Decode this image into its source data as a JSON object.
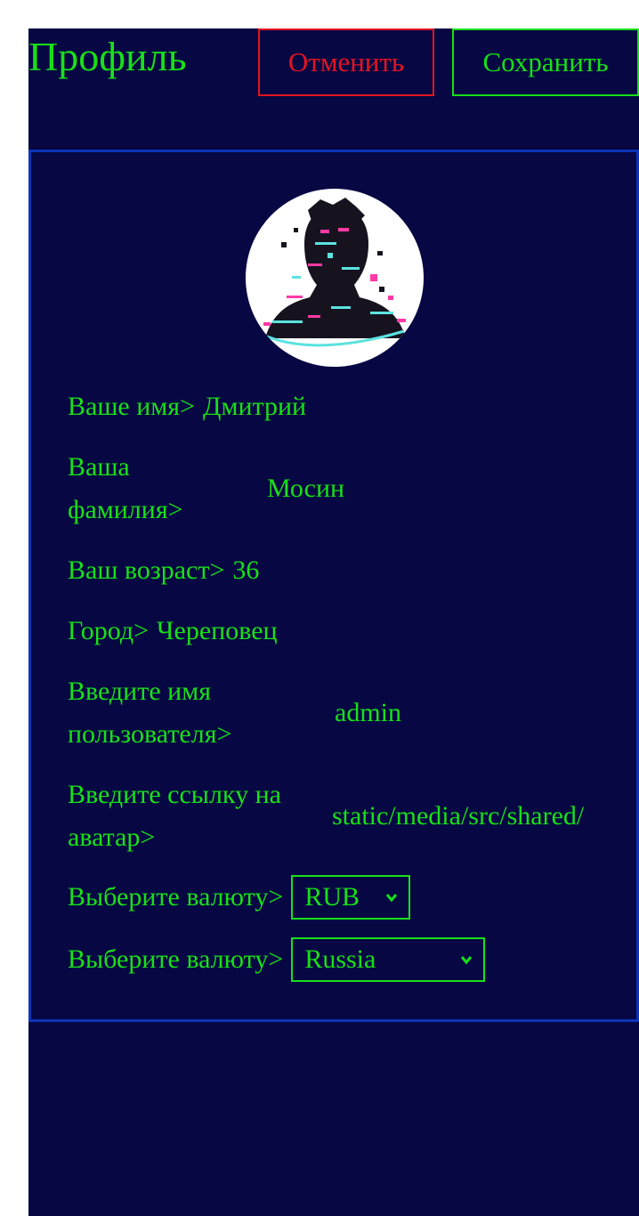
{
  "header": {
    "title": "Профиль",
    "cancel_label": "Отменить",
    "save_label": "Сохранить"
  },
  "profile": {
    "avatar_alt": "",
    "fields": [
      {
        "label": "Ваше имя>",
        "value": "Дмитрий"
      },
      {
        "label": "Ваша фамилия>",
        "value": "Мосин"
      },
      {
        "label": "Ваш возраст>",
        "value": "36"
      },
      {
        "label": "Город>",
        "value": "Череповец"
      },
      {
        "label": "Введите имя пользователя>",
        "value": "admin"
      },
      {
        "label": "Введите ссылку на аватар>",
        "value": "static/media/src/shared/"
      }
    ],
    "currency": {
      "label": "Выберите валюту>",
      "selected": "RUB"
    },
    "country": {
      "label": "Выберите валюту>",
      "selected": "Russia"
    }
  },
  "colors": {
    "background": "#070743",
    "text": "#18e018",
    "cancel": "#e3141f",
    "card_border": "#0c34b8"
  }
}
